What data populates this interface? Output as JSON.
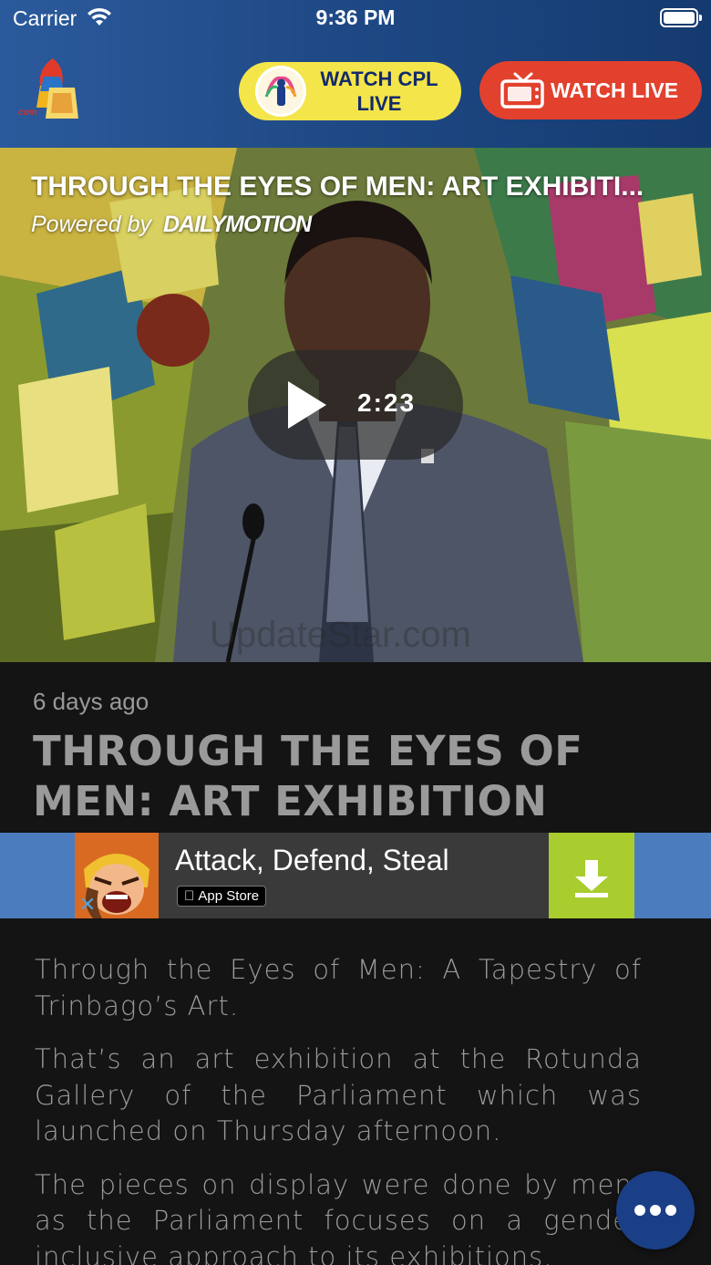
{
  "status_bar": {
    "carrier": "Carrier",
    "time": "9:36 PM"
  },
  "header": {
    "logo_icon": "tv6-logo",
    "watch_cpl_label": "WATCH CPL LIVE",
    "watch_live_label": "WATCH LIVE",
    "watch_cpl_color": "#f4e54a",
    "watch_live_color": "#e2412e"
  },
  "video": {
    "title": "THROUGH THE EYES OF MEN: ART EXHIBITI...",
    "powered_by": "Powered by",
    "provider": "DAILYMOTION",
    "duration": "2:23",
    "watermark": "UpdateStar.com"
  },
  "article": {
    "time_ago": "6 days ago",
    "title": "THROUGH THE EYES OF MEN: ART EXHIBITION",
    "paragraphs": [
      "Through the Eyes of Men: A Tapestry of Trinbago’s Art.",
      "That’s an art exhibition at the Rotunda Gallery of the Parliament which was launched on Thursday afternoon.",
      "The pieces on display were done by men, as the Parliament focuses on a gender inclusive approach to its exhibitions."
    ]
  },
  "ad": {
    "title": "Attack, Defend, Steal",
    "store_label": "App Store",
    "background": "#4a7cbe",
    "download_color": "#a9cc2e"
  },
  "fab": {
    "icon": "more-dots-icon",
    "color": "#1a3f86"
  }
}
